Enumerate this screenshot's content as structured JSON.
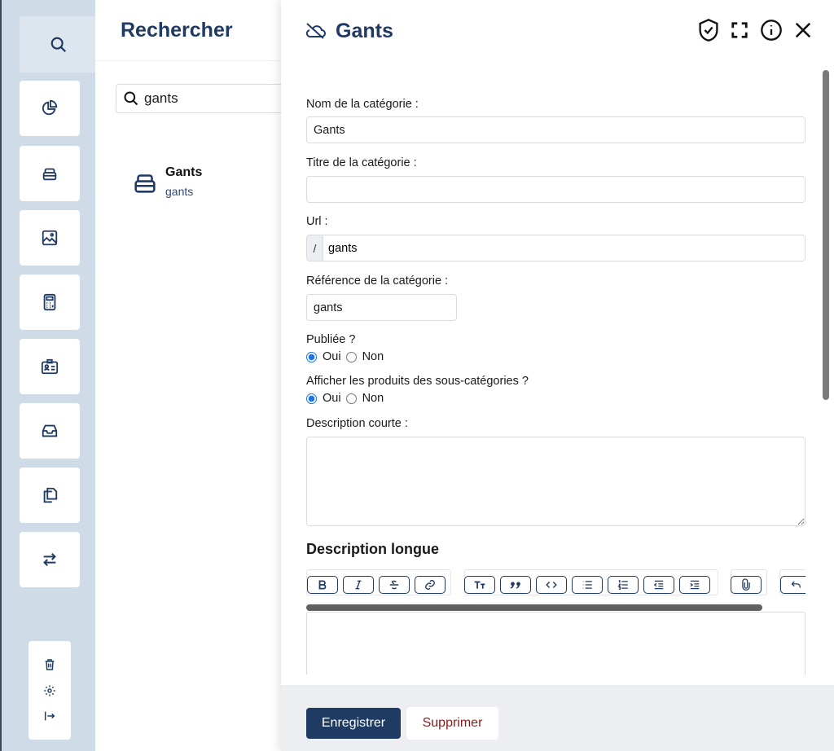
{
  "search": {
    "title": "Rechercher",
    "query": "gants",
    "result": {
      "title": "Gants",
      "subtitle": "gants"
    }
  },
  "panel": {
    "title": "Gants",
    "fields": {
      "name_label": "Nom de la catégorie :",
      "name_value": "Gants",
      "title_label": "Titre de la catégorie :",
      "title_value": "",
      "url_label": "Url :",
      "url_prefix": "/",
      "url_value": "gants",
      "ref_label": "Référence de la catégorie :",
      "ref_value": "gants",
      "published_label": "Publiée ?",
      "published_value": "Oui",
      "subcat_label": "Afficher les produits des sous-catégories ?",
      "subcat_value": "Oui",
      "yes": "Oui",
      "no": "Non",
      "short_desc_label": "Description courte :",
      "long_desc_label": "Description longue"
    },
    "toolbar": [
      "bold",
      "italic",
      "strikethrough",
      "link",
      "heading",
      "quote",
      "code",
      "bullet-list",
      "numbered-list",
      "outdent",
      "indent",
      "attach",
      "undo"
    ],
    "save_label": "Enregistrer",
    "delete_label": "Supprimer"
  },
  "colors": {
    "primary": "#1f3a63",
    "danger": "#8b1a1a",
    "rail": "#cfdbe6"
  }
}
